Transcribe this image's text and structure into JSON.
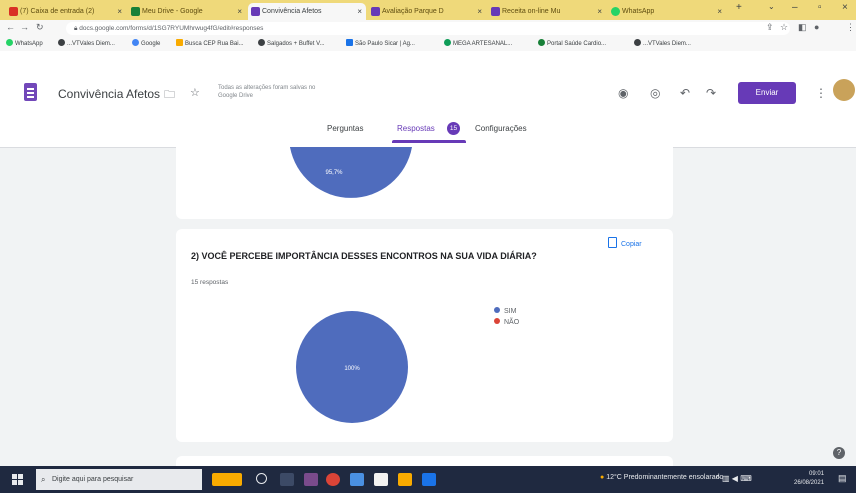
{
  "browser": {
    "tabs": [
      {
        "title": "(7) Caixa de entrada (2)",
        "icon_color": "#d93025",
        "active": false
      },
      {
        "title": "Meu Drive - Google",
        "icon_color": "#188038",
        "active": false
      },
      {
        "title": "Convivência Afetos",
        "icon_color": "#673ab7",
        "active": true
      },
      {
        "title": "Avaliação Parque D",
        "icon_color": "#673ab7",
        "active": false
      },
      {
        "title": "Receita on-line Mu",
        "icon_color": "#673ab7",
        "active": false
      },
      {
        "title": "WhatsApp",
        "icon_color": "#25d366",
        "active": false
      }
    ],
    "url": "docs.google.com/forms/d/1SG7RYUMhrwug4fG/edit#responses",
    "bookmarks": [
      {
        "label": "WhatsApp",
        "color": "#25d366"
      },
      {
        "label": "...VTVales Diem...",
        "color": "#3c4043"
      },
      {
        "label": "Google",
        "color": "#4285f4"
      },
      {
        "label": "Busca CEP Rua Bai...",
        "color": "#f9ab00"
      },
      {
        "label": "Salgados + Buffet V...",
        "color": "#3c4043"
      },
      {
        "label": "São Paulo Sicar | Ag...",
        "color": "#1a73e8"
      },
      {
        "label": "MEGA ARTESANAL...",
        "color": "#0f9d58"
      },
      {
        "label": "Portal Saúde Cardio...",
        "color": "#188038"
      },
      {
        "label": "...VTVales Diem...",
        "color": "#3c4043"
      }
    ]
  },
  "form": {
    "title": "Convivência Afetos",
    "save_info": "Todas as alterações foram salvas no Google Drive",
    "send_label": "Enviar",
    "tabs": {
      "questions": "Perguntas",
      "responses": "Respostas",
      "settings": "Configurações"
    },
    "response_count": "15"
  },
  "card1": {
    "label": "95,7%"
  },
  "question2": {
    "title": "2) VOCÊ PERCEBE IMPORTÂNCIA DESSES ENCONTROS NA SUA VIDA DIÁRIA?",
    "responses_text": "15 respostas",
    "copy_label": "Copiar"
  },
  "chart_data": {
    "type": "pie",
    "title": "2) VOCÊ PERCEBE IMPORTÂNCIA DESSES ENCONTROS NA SUA VIDA DIÁRIA?",
    "categories": [
      "SIM",
      "NÃO"
    ],
    "values": [
      100,
      0
    ],
    "data_labels": [
      "100%"
    ],
    "colors": [
      "#4f6cbd",
      "#db4437"
    ],
    "legend_position": "right"
  },
  "taskbar": {
    "search_placeholder": "Digite aqui para pesquisar",
    "weather": "12°C Predominantemente ensolarado",
    "time": "09:01",
    "date": "26/08/2021"
  }
}
